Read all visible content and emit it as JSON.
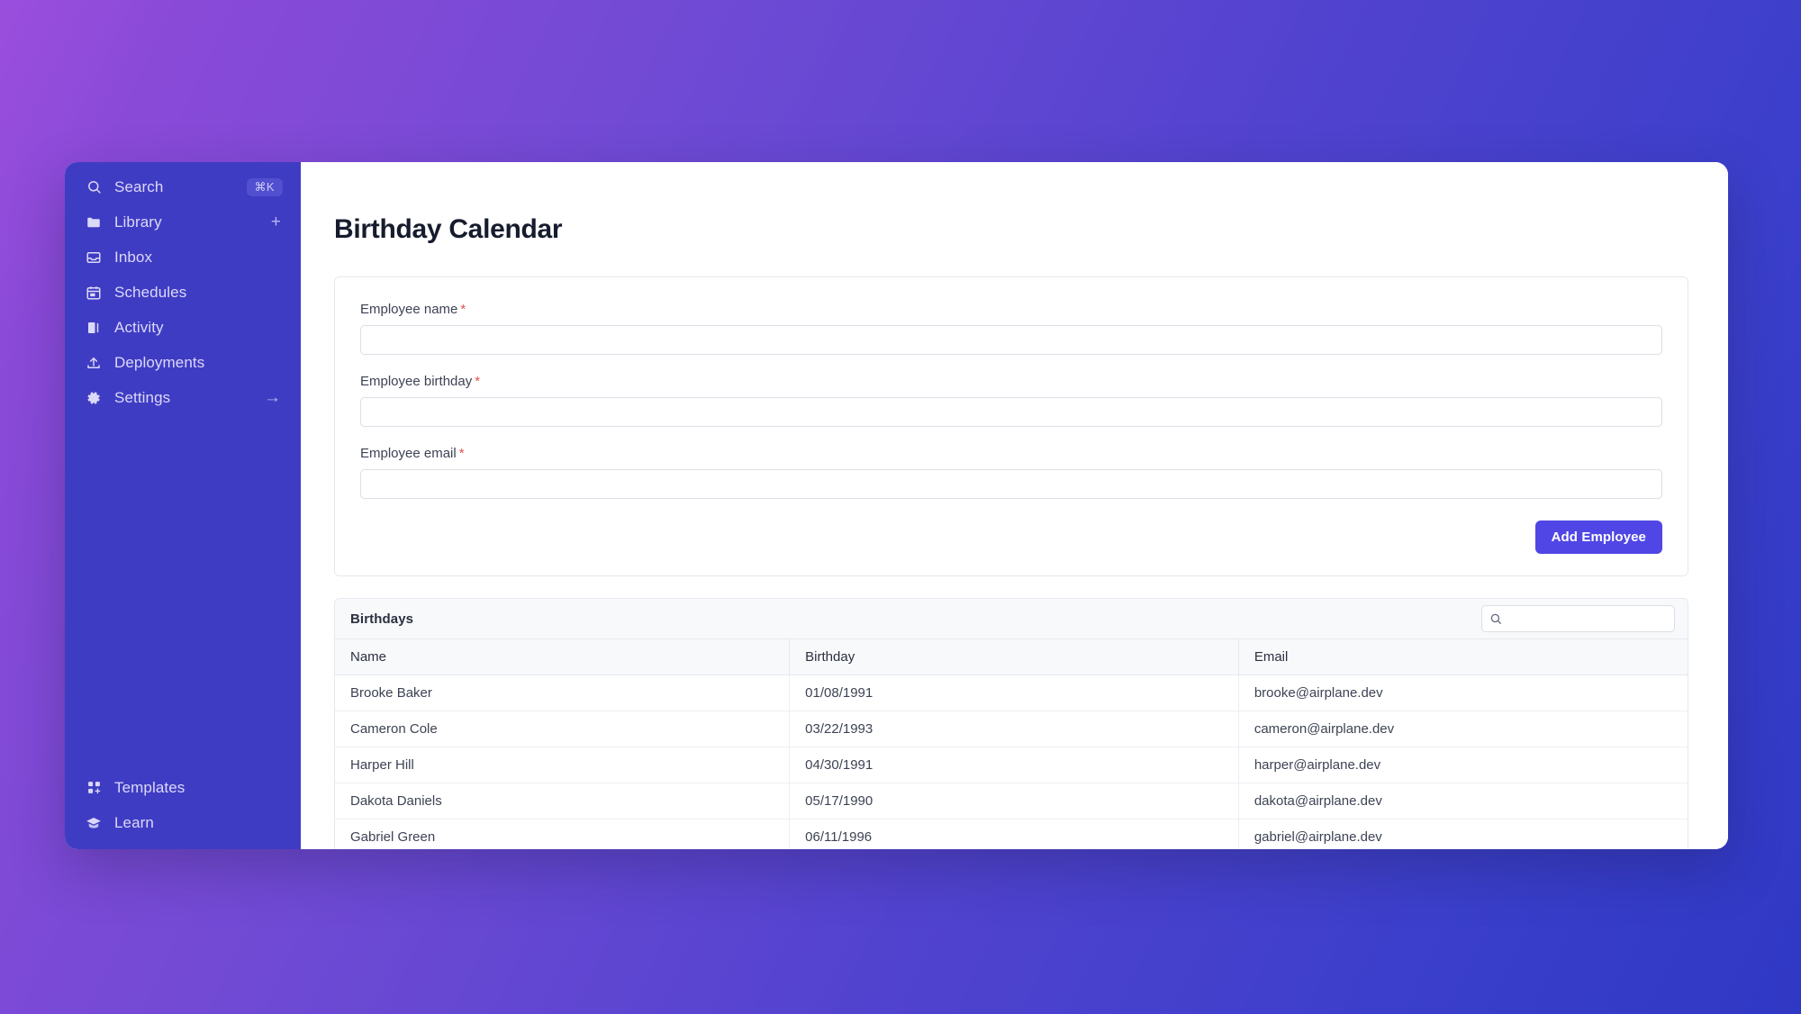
{
  "sidebar": {
    "items": [
      {
        "label": "Search",
        "icon": "search-icon",
        "badge": "⌘K",
        "trailing": ""
      },
      {
        "label": "Library",
        "icon": "folder-icon",
        "badge": "",
        "trailing": "+"
      },
      {
        "label": "Inbox",
        "icon": "inbox-icon",
        "badge": "",
        "trailing": ""
      },
      {
        "label": "Schedules",
        "icon": "calendar-icon",
        "badge": "",
        "trailing": ""
      },
      {
        "label": "Activity",
        "icon": "activity-icon",
        "badge": "",
        "trailing": ""
      },
      {
        "label": "Deployments",
        "icon": "upload-icon",
        "badge": "",
        "trailing": ""
      },
      {
        "label": "Settings",
        "icon": "gear-icon",
        "badge": "",
        "trailing": "→"
      }
    ],
    "bottom_items": [
      {
        "label": "Templates",
        "icon": "templates-icon"
      },
      {
        "label": "Learn",
        "icon": "graduation-cap-icon"
      }
    ]
  },
  "main": {
    "page_title": "Birthday Calendar",
    "form": {
      "fields": [
        {
          "label": "Employee name",
          "required": "*",
          "value": "",
          "placeholder": ""
        },
        {
          "label": "Employee birthday",
          "required": "*",
          "value": "",
          "placeholder": ""
        },
        {
          "label": "Employee email",
          "required": "*",
          "value": "",
          "placeholder": ""
        }
      ],
      "submit_label": "Add Employee"
    },
    "table": {
      "title": "Birthdays",
      "search_value": "",
      "search_placeholder": "",
      "columns": [
        "Name",
        "Birthday",
        "Email"
      ],
      "rows": [
        {
          "name": "Brooke Baker",
          "birthday": "01/08/1991",
          "email": "brooke@airplane.dev"
        },
        {
          "name": "Cameron Cole",
          "birthday": "03/22/1993",
          "email": "cameron@airplane.dev"
        },
        {
          "name": "Harper Hill",
          "birthday": "04/30/1991",
          "email": "harper@airplane.dev"
        },
        {
          "name": "Dakota Daniels",
          "birthday": "05/17/1990",
          "email": "dakota@airplane.dev"
        },
        {
          "name": "Gabriel Green",
          "birthday": "06/11/1996",
          "email": "gabriel@airplane.dev"
        }
      ]
    }
  },
  "colors": {
    "sidebar_bg": "#3f3cc4",
    "accent": "#5046e5",
    "required_star": "#e0524a",
    "background_gradient_from": "#9b4edd",
    "background_gradient_to": "#2f38c4"
  }
}
